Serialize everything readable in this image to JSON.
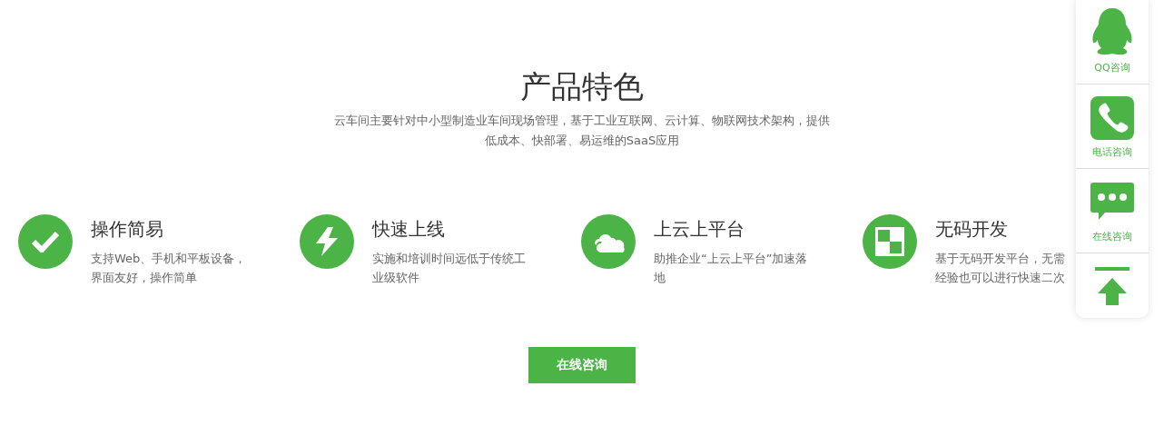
{
  "section": {
    "title": "产品特色",
    "subtitle_lines": [
      "云车间主要针对中小型制造业车间现场管理，基于工业互联网、云计算、物联网技术架构，提供",
      "低成本、快部署、易运维的SaaS应用"
    ]
  },
  "features": [
    {
      "kind": "check",
      "title": "操作简易",
      "lines": [
        "支持Web、手机和平板设备，",
        "界面友好，操作简单"
      ]
    },
    {
      "kind": "bolt",
      "title": "快速上线",
      "lines": [
        "实施和培训时间远低于传统工",
        "业级软件"
      ]
    },
    {
      "kind": "cloud",
      "title": "上云上平台",
      "lines": [
        "助推企业“上云上平台”加速落",
        "地"
      ]
    },
    {
      "kind": "blocks",
      "title": "无码开发",
      "lines": [
        "基于无码开发平台，无需",
        "经验也可以进行快速二次"
      ]
    }
  ],
  "cta_button": "在线咨询",
  "side_panel": [
    {
      "kind": "qq",
      "label": "QQ咨询"
    },
    {
      "kind": "phone",
      "label": "电话咨询"
    },
    {
      "kind": "chat",
      "label": "在线咨询"
    },
    {
      "kind": "top"
    }
  ]
}
